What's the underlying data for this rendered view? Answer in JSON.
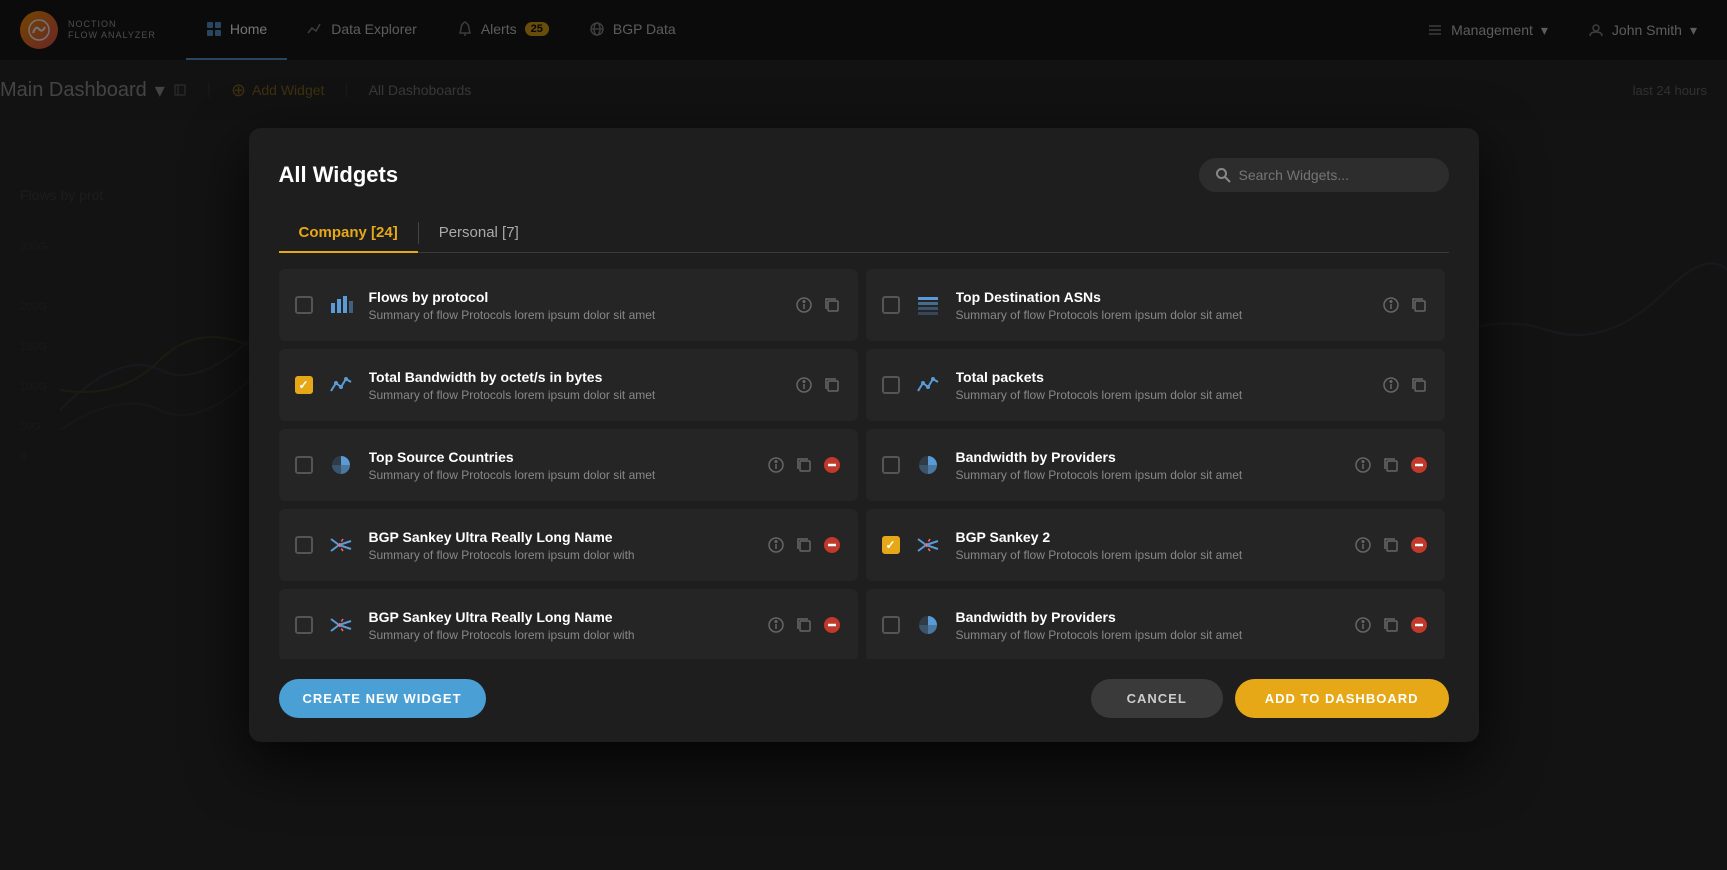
{
  "navbar": {
    "logo_text": "NOCTION",
    "logo_subtext": "FLOW ANALYZER",
    "home_label": "Home",
    "data_explorer_label": "Data Explorer",
    "alerts_label": "Alerts",
    "alerts_badge": "25",
    "bgp_data_label": "BGP Data",
    "management_label": "Management",
    "user_label": "John Smith"
  },
  "subheader": {
    "dashboard_name": "Main Dashboard",
    "add_widget_label": "Add Widget",
    "all_dashboards_label": "All Dashoboards",
    "time_range": "last 24 hours"
  },
  "modal": {
    "title": "All Widgets",
    "search_placeholder": "Search Widgets...",
    "tab_company": "Company [24]",
    "tab_personal": "Personal [7]",
    "widgets_left": [
      {
        "id": "w1",
        "name": "Flows by protocol",
        "desc": "Summary of flow Protocols lorem ipsum dolor sit amet",
        "icon": "bar",
        "checked": false,
        "has_delete": false
      },
      {
        "id": "w2",
        "name": "Total Bandwidth by octet/s in bytes",
        "desc": "Summary of flow Protocols lorem ipsum dolor sit amet",
        "icon": "line",
        "checked": true,
        "has_delete": false
      },
      {
        "id": "w3",
        "name": "Top Source Countries",
        "desc": "Summary of flow Protocols lorem ipsum dolor sit amet",
        "icon": "pie",
        "checked": false,
        "has_delete": true
      },
      {
        "id": "w4",
        "name": "BGP Sankey Ultra Really Long Name",
        "desc": "Summary of flow Protocols lorem ipsum dolor with",
        "icon": "sankey",
        "checked": false,
        "has_delete": true
      },
      {
        "id": "w5",
        "name": "BGP Sankey Ultra Really Long Name",
        "desc": "Summary of flow Protocols lorem ipsum dolor with",
        "icon": "sankey",
        "checked": false,
        "has_delete": true
      }
    ],
    "widgets_right": [
      {
        "id": "w6",
        "name": "Top Destination ASNs",
        "desc": "Summary of flow Protocols lorem ipsum dolor sit amet",
        "icon": "table",
        "checked": false,
        "has_delete": false
      },
      {
        "id": "w7",
        "name": "Total packets",
        "desc": "Summary of flow Protocols lorem ipsum dolor sit amet",
        "icon": "line",
        "checked": false,
        "has_delete": false
      },
      {
        "id": "w8",
        "name": "Bandwidth by Providers",
        "desc": "Summary of flow Protocols lorem ipsum dolor sit amet",
        "icon": "pie",
        "checked": false,
        "has_delete": true
      },
      {
        "id": "w9",
        "name": "BGP Sankey 2",
        "desc": "Summary of flow Protocols lorem ipsum dolor sit amet",
        "icon": "sankey",
        "checked": true,
        "has_delete": true
      },
      {
        "id": "w10",
        "name": "Bandwidth by Providers",
        "desc": "Summary of flow Protocols lorem ipsum dolor sit amet",
        "icon": "pie",
        "checked": false,
        "has_delete": true
      }
    ],
    "create_new_label": "CREATE NEW WIDGET",
    "cancel_label": "CANCEL",
    "add_to_dashboard_label": "ADD TO DASHBOARD"
  },
  "colors": {
    "accent_orange": "#e6a817",
    "accent_blue": "#4a9fd4",
    "icon_blue": "#5b9bd5",
    "checked_bg": "#e6a817",
    "delete_red": "#c0392b"
  }
}
